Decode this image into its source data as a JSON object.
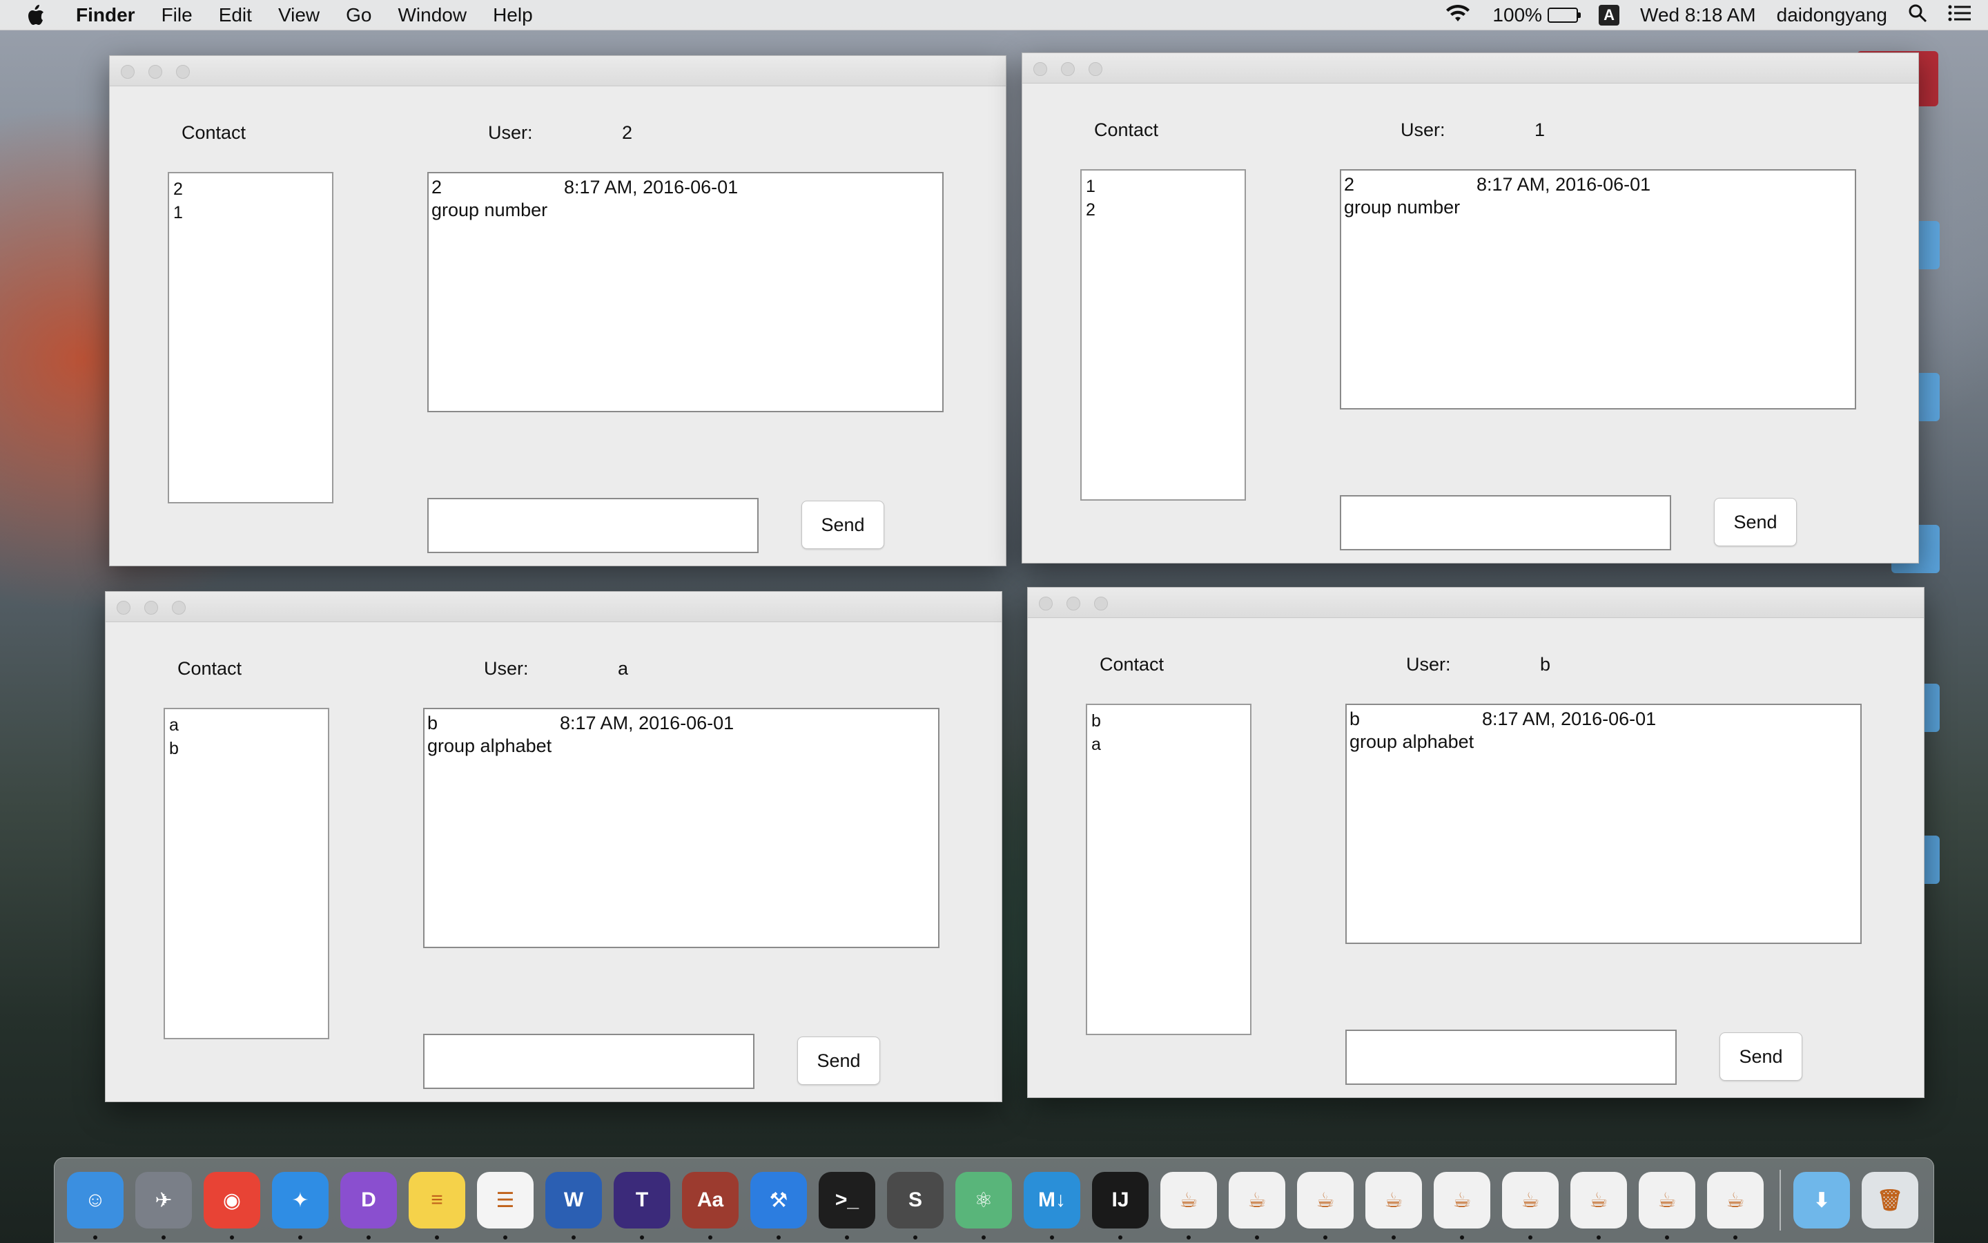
{
  "menubar": {
    "app_name": "Finder",
    "menus": [
      "File",
      "Edit",
      "View",
      "Go",
      "Window",
      "Help"
    ],
    "battery": "100%",
    "input_source": "A",
    "clock": "Wed 8:18 AM",
    "user": "daidongyang"
  },
  "windows": [
    {
      "contact_heading": "Contact",
      "user_label": "User:",
      "user_value": "2",
      "contacts": [
        "2",
        "1"
      ],
      "messages": [
        {
          "sender": "2",
          "time": "8:17 AM, 2016-06-01",
          "body": "group number"
        }
      ],
      "compose_value": "",
      "send_label": "Send"
    },
    {
      "contact_heading": "Contact",
      "user_label": "User:",
      "user_value": "1",
      "contacts": [
        "1",
        "2"
      ],
      "messages": [
        {
          "sender": "2",
          "time": "8:17 AM, 2016-06-01",
          "body": "group number"
        }
      ],
      "compose_value": "",
      "send_label": "Send"
    },
    {
      "contact_heading": "Contact",
      "user_label": "User:",
      "user_value": "a",
      "contacts": [
        "a",
        "b"
      ],
      "messages": [
        {
          "sender": "b",
          "time": "8:17 AM, 2016-06-01",
          "body": "group alphabet"
        }
      ],
      "compose_value": "",
      "send_label": "Send"
    },
    {
      "contact_heading": "Contact",
      "user_label": "User:",
      "user_value": "b",
      "contacts": [
        "b",
        "a"
      ],
      "messages": [
        {
          "sender": "b",
          "time": "8:17 AM, 2016-06-01",
          "body": "group alphabet"
        }
      ],
      "compose_value": "",
      "send_label": "Send"
    }
  ],
  "dock": {
    "apps": [
      {
        "icon": "finder-icon",
        "color": "#3b8fe0",
        "glyph": "☺"
      },
      {
        "icon": "launchpad-icon",
        "color": "#7a7f88",
        "glyph": "✈"
      },
      {
        "icon": "chrome-icon",
        "color": "#e84335",
        "glyph": "◉"
      },
      {
        "icon": "safari-icon",
        "color": "#2f8de4",
        "glyph": "✦"
      },
      {
        "icon": "dash-icon",
        "color": "#8a4fcf",
        "glyph": "D"
      },
      {
        "icon": "notes-icon",
        "color": "#f5d24a",
        "glyph": "≡"
      },
      {
        "icon": "reminders-icon",
        "color": "#f4f4f4",
        "glyph": "☰"
      },
      {
        "icon": "word-icon",
        "color": "#2b5fb3",
        "glyph": "W"
      },
      {
        "icon": "texshop-icon",
        "color": "#3b2a7a",
        "glyph": "T"
      },
      {
        "icon": "dictionary-icon",
        "color": "#9c3b2f",
        "glyph": "Aa"
      },
      {
        "icon": "xcode-icon",
        "color": "#2c7de0",
        "glyph": "⚒"
      },
      {
        "icon": "terminal-icon",
        "color": "#1e1e1e",
        "glyph": ">_"
      },
      {
        "icon": "sublime-text-icon",
        "color": "#4a4a4a",
        "glyph": "S"
      },
      {
        "icon": "atom-icon",
        "color": "#59b57a",
        "glyph": "⚛"
      },
      {
        "icon": "markdown-icon",
        "color": "#2a8fd8",
        "glyph": "M↓"
      },
      {
        "icon": "intellij-icon",
        "color": "#1a1a1a",
        "glyph": "IJ"
      },
      {
        "icon": "java-icon",
        "color": "#f1f1f1",
        "glyph": "☕"
      },
      {
        "icon": "java-icon",
        "color": "#f1f1f1",
        "glyph": "☕"
      },
      {
        "icon": "java-icon",
        "color": "#f1f1f1",
        "glyph": "☕"
      },
      {
        "icon": "java-icon",
        "color": "#f1f1f1",
        "glyph": "☕"
      },
      {
        "icon": "java-icon",
        "color": "#f1f1f1",
        "glyph": "☕"
      },
      {
        "icon": "java-icon",
        "color": "#f1f1f1",
        "glyph": "☕"
      },
      {
        "icon": "java-icon",
        "color": "#f1f1f1",
        "glyph": "☕"
      },
      {
        "icon": "java-icon",
        "color": "#f1f1f1",
        "glyph": "☕"
      },
      {
        "icon": "java-icon",
        "color": "#f1f1f1",
        "glyph": "☕"
      }
    ],
    "extras": [
      {
        "icon": "downloads-folder-icon",
        "color": "#6fb7ea",
        "glyph": "⬇"
      },
      {
        "icon": "trash-icon",
        "color": "#dfe3e6",
        "glyph": "🗑"
      }
    ]
  }
}
